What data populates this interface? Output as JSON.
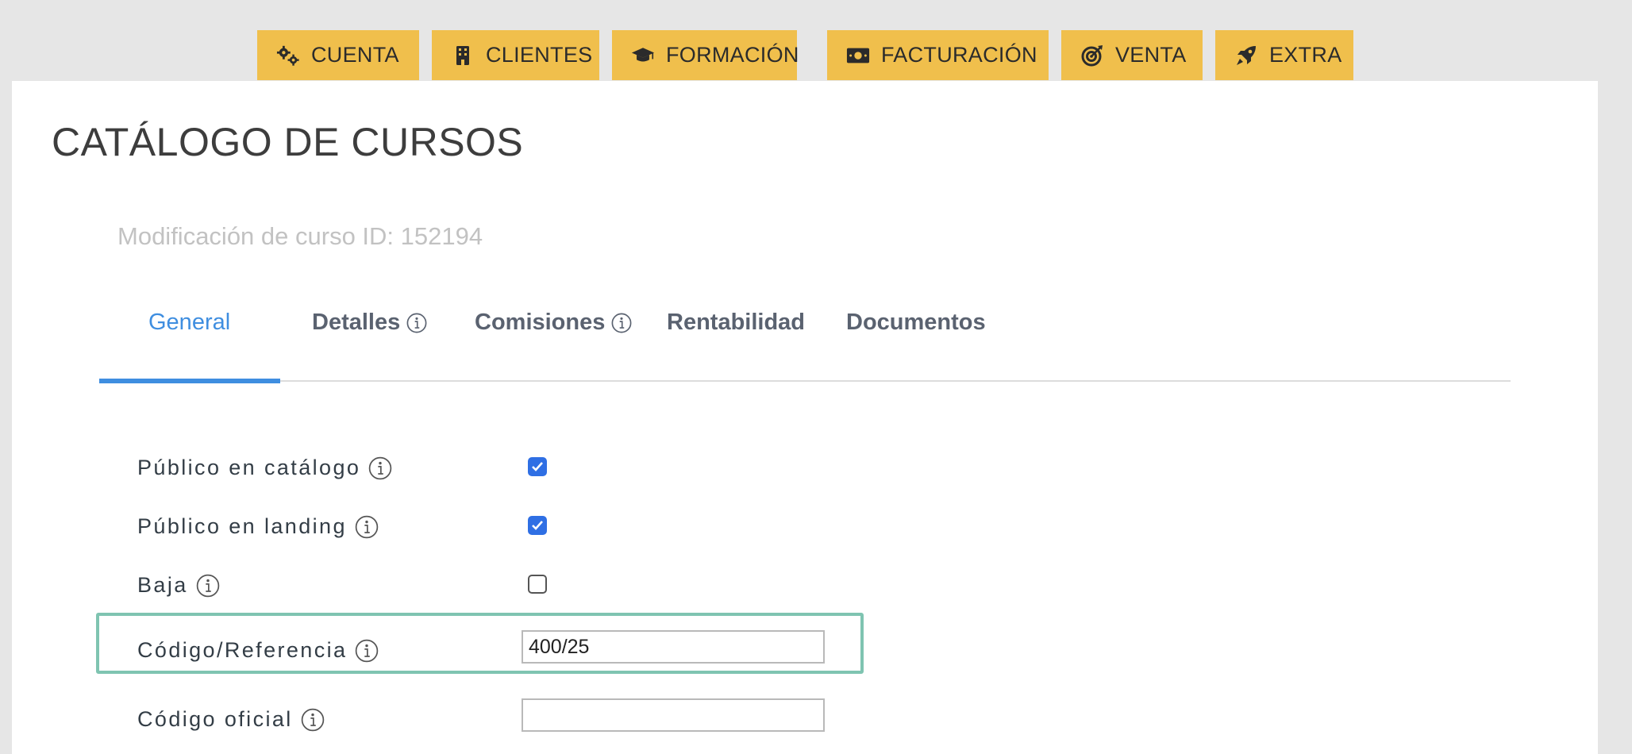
{
  "nav": [
    {
      "label": "CUENTA",
      "icon": "gears-icon"
    },
    {
      "label": "CLIENTES",
      "icon": "building-icon"
    },
    {
      "label": "FORMACIÓN",
      "icon": "graduation-cap-icon"
    },
    {
      "label": "FACTURACIÓN",
      "icon": "money-bill-icon"
    },
    {
      "label": "VENTA",
      "icon": "target-icon"
    },
    {
      "label": "EXTRA",
      "icon": "rocket-icon"
    }
  ],
  "page": {
    "title": "CATÁLOGO DE CURSOS",
    "subtitle": "Modificación de curso ID: 152194"
  },
  "tabs": [
    {
      "label": "General",
      "active": true
    },
    {
      "label": "Detalles",
      "info": true
    },
    {
      "label": "Comisiones",
      "info": true
    },
    {
      "label": "Rentabilidad"
    },
    {
      "label": "Documentos"
    }
  ],
  "form": {
    "publico_catalogo": {
      "label": "Público en catálogo",
      "checked": true
    },
    "publico_landing": {
      "label": "Público en landing",
      "checked": true
    },
    "baja": {
      "label": "Baja",
      "checked": false
    },
    "codigo_referencia": {
      "label": "Código/Referencia",
      "value": "400/25"
    },
    "codigo_oficial": {
      "label": "Código oficial",
      "value": ""
    }
  },
  "colors": {
    "nav_button": "#f0bf4c",
    "tab_active": "#3f8ee0",
    "checkbox_checked": "#2f6fe4",
    "highlight_border": "#7fc4b1"
  }
}
